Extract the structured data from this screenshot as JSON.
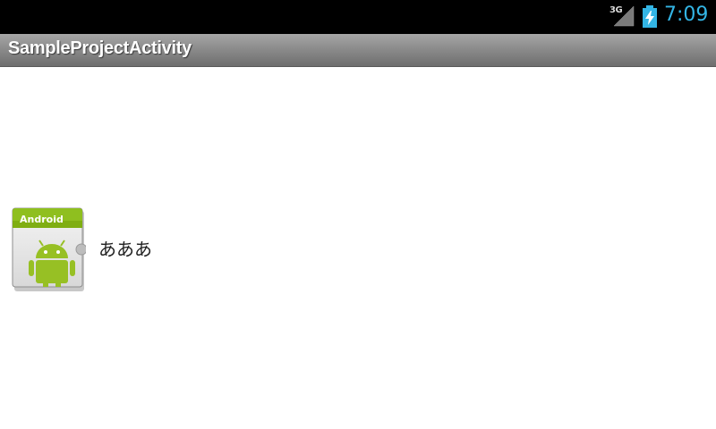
{
  "status_bar": {
    "network_type": "3G",
    "time": "7:09",
    "signal_icon": "signal-strength-icon",
    "battery_icon": "battery-charging-icon",
    "accent_color": "#33b5e5"
  },
  "action_bar": {
    "title": "SampleProjectActivity"
  },
  "list": {
    "items": [
      {
        "icon": "android-app-icon",
        "icon_banner_text": "Android",
        "label": "あああ"
      }
    ]
  }
}
